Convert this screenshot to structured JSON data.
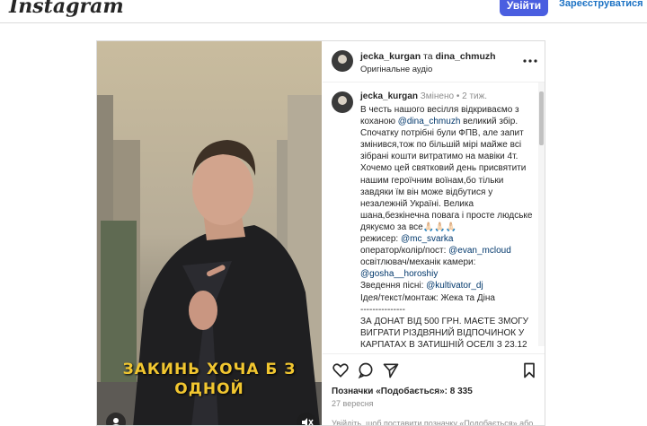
{
  "topbar": {
    "logo": "Instagram",
    "login_label": "Увійти",
    "register_label": "Зареєструватися"
  },
  "post": {
    "header": {
      "user1": "jecka_kurgan",
      "joiner": " та ",
      "user2": "dina_chmuzh",
      "audio": "Оригінальне аудіо",
      "more_icon": "more-horizontal-icon"
    },
    "media": {
      "overlay_line1": "ЗАКИНЬ ХОЧА Б З",
      "overlay_line2": "ОДНОЙ"
    },
    "caption": {
      "username": "jecka_kurgan",
      "edited": "Змінено",
      "dot": "•",
      "age": "2 тиж.",
      "t1": "В честь нашого весілля відкриваємо з коханою ",
      "m1": "@dina_chmuzh",
      "t2": " великий збір. Спочатку потрібні були ФПВ, але запит змінився,тож по більшій мірі майже всі зібрані кошти витратимо на мавіки 4т. Хочемо цей святковий день присвятити нашим героїчним воїнам,бо тільки завдяки їм він може відбутися у незалежній Україні. Велика шана,безкінечна повага і просте людське дякуємо за все🙏🏻🙏🏻🙏🏻",
      "l_dir": "режисер: ",
      "m_dir": "@mc_svarka",
      "l_op": "оператор/колір/пост: ",
      "m_op": "@evan_mcloud",
      "l_light": "освітлювач/механік камери: ",
      "m_light": "@gosha__horoshiy",
      "l_mix": "Зведення пісні: ",
      "m_mix": "@kultivator_dj",
      "idea": "Ідея/текст/монтаж: Жека та Діна",
      "sep": "---------------",
      "donate": "ЗА ДОНАТ ВІД 500 ГРН. МАЄТЕ ЗМОГУ ВИГРАТИ РІЗДВЯНИЙ ВІДПОЧИНОК У КАРПАТАХ В ЗАТИШНІЙ ОСЕЛІ З 23.12"
    },
    "actions": {
      "like_icon": "heart-icon",
      "comment_icon": "comment-icon",
      "share_icon": "share-icon",
      "save_icon": "bookmark-icon",
      "likes_label": "Позначки «Подобається»: 8 335",
      "date": "27 вересня",
      "login_hint": "Увійдіть, щоб поставити позначку «Подобається» або прокоментувати."
    }
  },
  "colors": {
    "primary_button": "#4a5ee0",
    "link": "#00376b",
    "overlay_text": "#f1c630"
  }
}
